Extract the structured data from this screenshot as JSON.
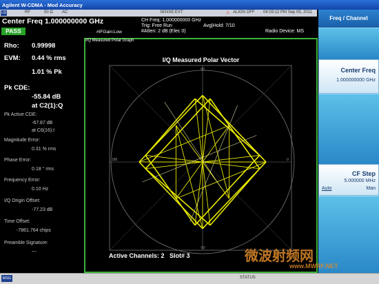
{
  "window": {
    "title": "Agilent W-CDMA - Mod Accuracy"
  },
  "status_strip": {
    "rf": "RF",
    "impedance": "50 Ω",
    "coupling": "AC",
    "sense": "SENSE:EXT",
    "align": "ALIGN OFF",
    "timestamp": "04:03:12 PM Sep 05, 2011"
  },
  "header": {
    "center_freq_label": "Center Freq",
    "center_freq_value": "1.000000000 GHz",
    "pass_label": "PASS",
    "ifgain": "#IFGain:Low",
    "ch_freq": "CH Freq: 1.000000000 GHz",
    "trig": "Trig: Free Run",
    "avg_hold": "Avg|Hold: 7/10",
    "atten": "#Atten: 2 dB (Elec 0)",
    "radio_device": "Radio Device: MS"
  },
  "metrics": {
    "rho_label": "Rho:",
    "rho_value": "0.99998",
    "evm_label": "EVM:",
    "evm_value": "0.44 % rms",
    "evm_pk": "1.01 % Pk",
    "pk_cde_label": "Pk CDE:",
    "pk_cde_value": "-55.84 dB",
    "pk_cde_at": "at C2(1):Q",
    "pk_active_cde_label": "Pk Active CDE:",
    "pk_active_cde_value": "-67.87 dB",
    "pk_active_cde_at": "at C6(16):I",
    "mag_error_label": "Magnitude Error:",
    "mag_error_value": "0.31 % rms",
    "phase_error_label": "Phase Error:",
    "phase_error_value": "0.18 ° rms",
    "freq_error_label": "Frequency Error:",
    "freq_error_value": "0.10 Hz",
    "iq_offset_label": "I/Q Origin Offset:",
    "iq_offset_value": "-77.23 dB",
    "time_offset_label": "Time Offset:",
    "time_offset_value": "-7861.764 chips",
    "preamble_label": "Preamble Signature:",
    "preamble_value": "---"
  },
  "graph": {
    "window_title": "I/Q Measured Polar Graph",
    "plot_title": "I/Q Measured Polar Vector",
    "axis_top": "90",
    "axis_bottom": "-90",
    "axis_left": "180",
    "axis_right": "0",
    "active_channels": "Active Channels: 2",
    "slot": "Slot# 3",
    "trace_color": "#e8e800",
    "grid_color": "#777777"
  },
  "softkeys": {
    "menu_title": "Freq / Channel",
    "center_freq_label": "Center Freq",
    "center_freq_value": "1.000000000 GHz",
    "cf_step_label": "CF Step",
    "cf_step_value": "5.000000 MHz",
    "cf_step_auto": "Auto",
    "cf_step_man": "Man"
  },
  "bottom": {
    "msg": "MSG",
    "status": "STATUS",
    "watermark_cn": "微波射频网",
    "watermark_url": "www.MWRF.NET"
  }
}
